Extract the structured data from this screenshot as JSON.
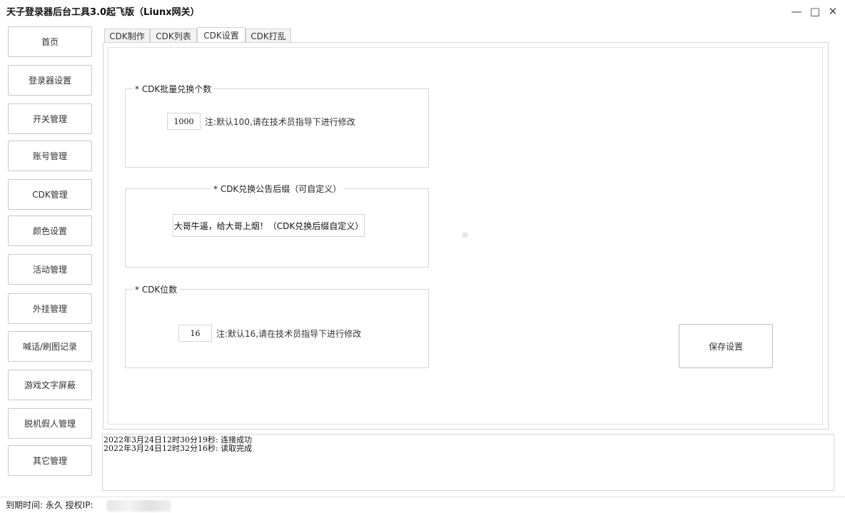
{
  "window": {
    "title": "天子登录器后台工具3.0起飞版（Liunx网关）"
  },
  "window_controls": {
    "minimize": "—",
    "maximize": "□",
    "close": "✕"
  },
  "sidebar": {
    "items": [
      {
        "label": "首页"
      },
      {
        "label": "登录器设置"
      },
      {
        "label": "开关管理"
      },
      {
        "label": "账号管理"
      },
      {
        "label": "CDK管理"
      },
      {
        "label": "颜色设置"
      },
      {
        "label": "活动管理"
      },
      {
        "label": "外挂管理"
      },
      {
        "label": "喊话/刷图记录"
      },
      {
        "label": "游戏文字屏蔽"
      },
      {
        "label": "脱机假人管理"
      },
      {
        "label": "其它管理"
      }
    ]
  },
  "tabs": [
    {
      "label": "CDK制作"
    },
    {
      "label": "CDK列表"
    },
    {
      "label": "CDK设置"
    },
    {
      "label": "CDK打乱"
    }
  ],
  "active_tab": "CDK设置",
  "cdk_batch": {
    "legend": "* CDK批量兑换个数",
    "value": "1000",
    "note": "注:默认100,请在技术员指导下进行修改"
  },
  "cdk_suffix": {
    "legend": "* CDK兑换公告后缀（可自定义）",
    "value": "大哥牛逼，给大哥上烟！（CDK兑换后缀自定义）"
  },
  "cdk_digits": {
    "legend": "* CDK位数",
    "value": "16",
    "note": "注:默认16,请在技术员指导下进行修改"
  },
  "save_button": "保存设置",
  "log": {
    "lines": [
      "2022年3月24日12时30分19秒: 连接成功",
      "2022年3月24日12时32分16秒: 读取完成"
    ]
  },
  "status_bar": {
    "text": "到期时间: 永久  授权IP:"
  }
}
